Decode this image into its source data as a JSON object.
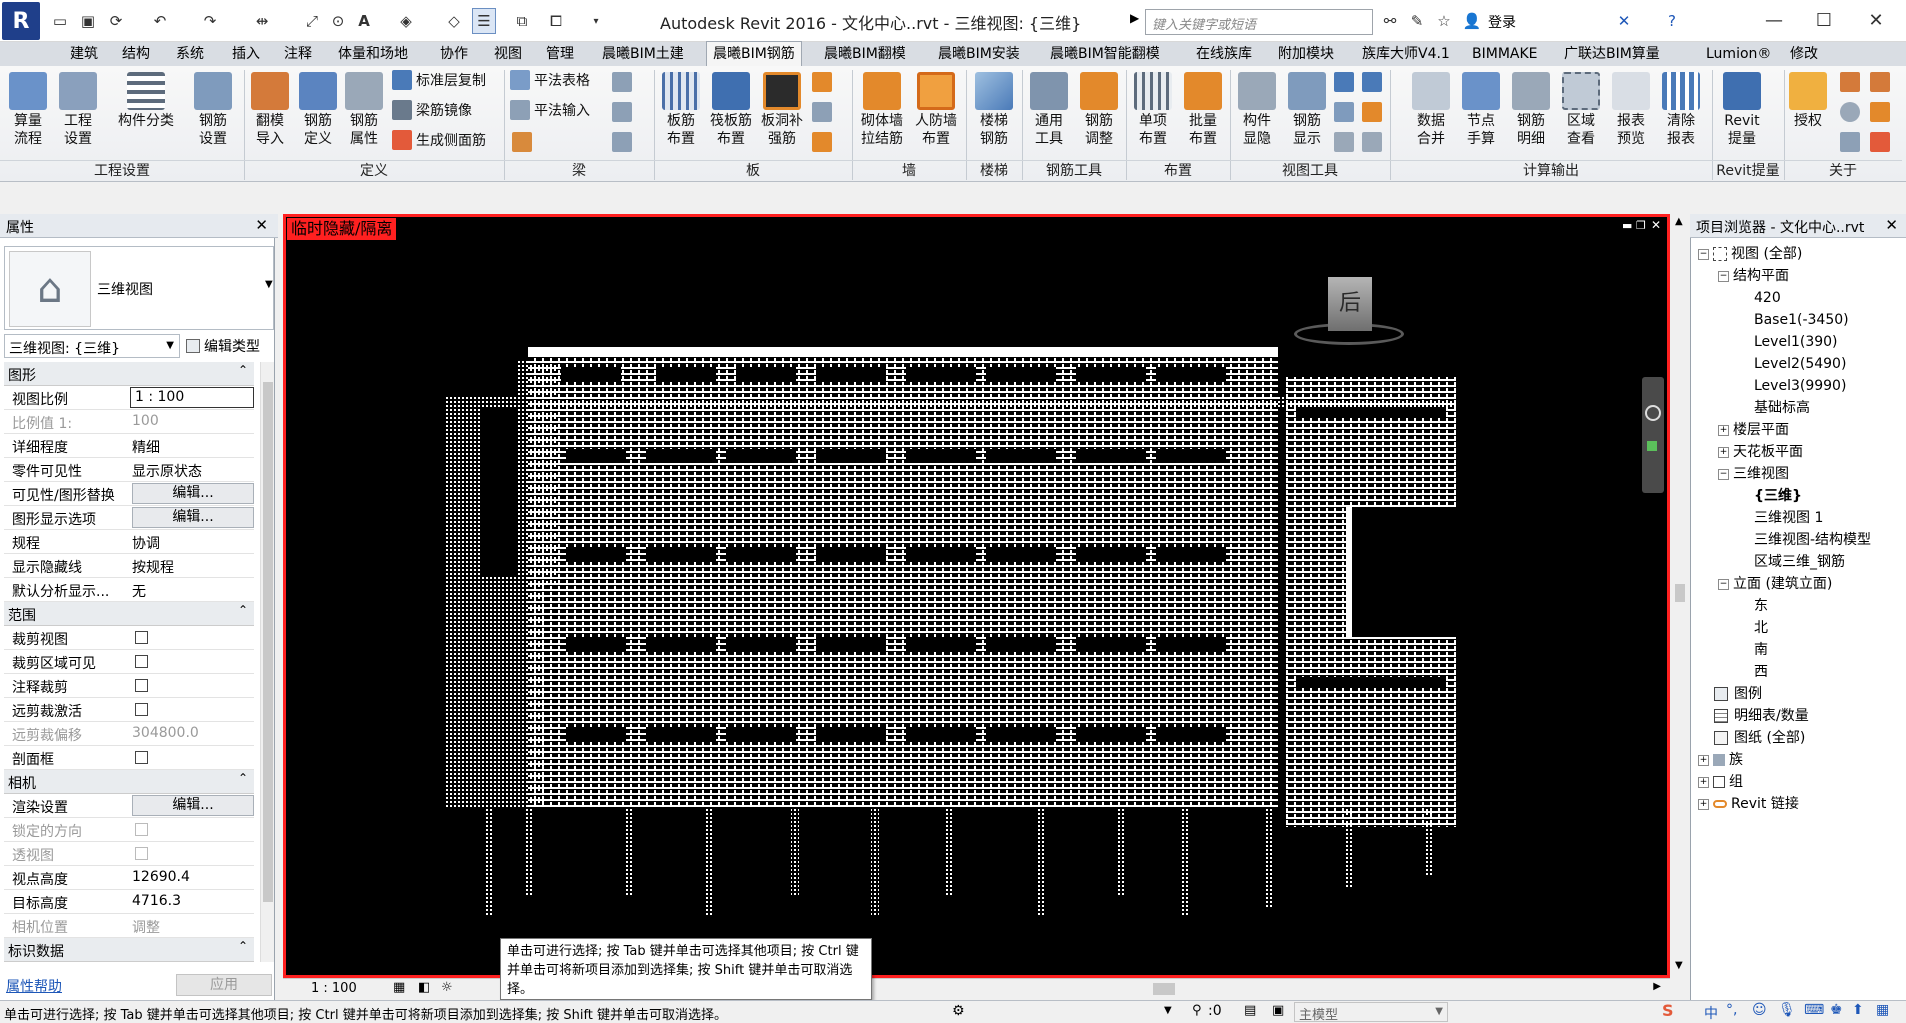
{
  "window": {
    "title": "Autodesk Revit 2016 -    文化中心..rvt - 三维视图: {三维}",
    "search_placeholder": "键入关键字或短语",
    "login_label": "登录"
  },
  "menu": {
    "tabs": [
      "建筑",
      "结构",
      "系统",
      "插入",
      "注释",
      "体量和场地",
      "协作",
      "视图",
      "管理",
      "晨曦BIM土建",
      "晨曦BIM钢筋",
      "晨曦BIM翻模",
      "晨曦BIM安装",
      "晨曦BIM智能翻模",
      "在线族库",
      "附加模块",
      "族库大师V4.1",
      "BIMMAKE",
      "广联达BIM算量",
      "Lumion®",
      "修改"
    ],
    "active": "晨曦BIM钢筋"
  },
  "ribbon": {
    "groups": [
      "工程设置",
      "定义",
      "梁",
      "板",
      "墙",
      "楼梯",
      "钢筋工具",
      "布置",
      "视图工具",
      "计算输出",
      "Revit提量",
      "关于"
    ],
    "buttons": {
      "suanliang": "算量\n流程",
      "gongcheng": "工程\n设置",
      "goujian": "构件分类",
      "gangjin_shezhi": "钢筋\n设置",
      "fanmo": "翻模\n导入",
      "gangjin_dingyi": "钢筋\n定义",
      "gangjin_shuxing": "钢筋\n属性",
      "banjin": "板筋\n布置",
      "fabanjin": "筏板筋\n布置",
      "bandong": "板洞补\n强筋",
      "qitiqiang": "砌体墙\n拉结筋",
      "renfang": "人防墙\n布置",
      "louti": "楼梯\n钢筋",
      "tongyong": "通用\n工具",
      "gangjin_tiaozheng": "钢筋\n调整",
      "danxiang": "单项\n布置",
      "piliang": "批量\n布置",
      "goujian_xianyin": "构件\n显隐",
      "gangjin_xianshi": "钢筋\n显示",
      "shuju": "数据\n合并",
      "jiedian": "节点\n手算",
      "gangjin_mingxi": "钢筋\n明细",
      "quyu": "区域\n查看",
      "baobiao_yulan": "报表\n预览",
      "qingchu": "清除\n报表",
      "revit": "Revit\n提量",
      "shouquan": "授权"
    },
    "small": {
      "biaozhunceng": "标准层复制",
      "liangjin": "梁筋镜像",
      "shengcheng": "生成侧面筋",
      "pingfa_biaoge": "平法表格",
      "pingfa_shuru": "平法输入"
    }
  },
  "properties": {
    "header": "属性",
    "type_name": "三维视图",
    "view_selector": "三维视图: {三维}",
    "edit_type": "编辑类型",
    "sections": {
      "graphics": "图形",
      "extents": "范围",
      "camera": "相机",
      "identity": "标识数据"
    },
    "rows": {
      "scale": {
        "label": "视图比例",
        "value": "1 : 100"
      },
      "scale_value": {
        "label": "比例值 1:",
        "value": "100"
      },
      "detail": {
        "label": "详细程度",
        "value": "精细"
      },
      "parts": {
        "label": "零件可见性",
        "value": "显示原状态"
      },
      "vg": {
        "label": "可见性/图形替换",
        "value": "编辑..."
      },
      "display": {
        "label": "图形显示选项",
        "value": "编辑..."
      },
      "discipline": {
        "label": "规程",
        "value": "协调"
      },
      "hidden": {
        "label": "显示隐藏线",
        "value": "按规程"
      },
      "analysis": {
        "label": "默认分析显示...",
        "value": "无"
      },
      "crop": {
        "label": "裁剪视图"
      },
      "crop_visible": {
        "label": "裁剪区域可见"
      },
      "anno_crop": {
        "label": "注释裁剪"
      },
      "far_clip": {
        "label": "远剪裁激活"
      },
      "far_offset": {
        "label": "远剪裁偏移",
        "value": "304800.0"
      },
      "section_box": {
        "label": "剖面框"
      },
      "render": {
        "label": "渲染设置",
        "value": "编辑..."
      },
      "locked": {
        "label": "锁定的方向"
      },
      "perspective": {
        "label": "透视图"
      },
      "eye": {
        "label": "视点高度",
        "value": "12690.4"
      },
      "target": {
        "label": "目标高度",
        "value": "4716.3"
      },
      "camera_pos": {
        "label": "相机位置",
        "value": "调整"
      }
    },
    "help": "属性帮助",
    "apply": "应用"
  },
  "viewport": {
    "isolate_label": "临时隐藏/隔离",
    "viewcube_face": "后",
    "scale": "1 : 100"
  },
  "browser": {
    "header": "项目浏览器 - 文化中心..rvt",
    "items": [
      "视图 (全部)",
      "结构平面",
      "420",
      "Base1(-3450)",
      "Level1(390)",
      "Level2(5490)",
      "Level3(9990)",
      "基础标高",
      "楼层平面",
      "天花板平面",
      "三维视图",
      "{三维}",
      "三维视图 1",
      "三维视图-结构模型",
      "区域三维_钢筋",
      "立面 (建筑立面)",
      "东",
      "北",
      "南",
      "西",
      "图例",
      "明细表/数量",
      "图纸 (全部)",
      "族",
      "组",
      "Revit 链接"
    ]
  },
  "status": {
    "text": "单击可进行选择; 按 Tab 键并单击可选择其他项目; 按 Ctrl 键并单击可将新项目添加到选择集; 按 Shift 键并单击可取消选择。",
    "tooltip": "单击可进行选择; 按 Tab 键并单击可选择其他项目; 按 Ctrl 键并单击可将新项目添加到选择集; 按 Shift 键并单击可取消选择。",
    "zero": ":0",
    "model": "主模型",
    "ime": "中"
  },
  "colors": {
    "accent_red": "#ff2020",
    "ribbon_icon_blue": "#4a7ab8",
    "ribbon_icon_orange": "#e3892b"
  }
}
